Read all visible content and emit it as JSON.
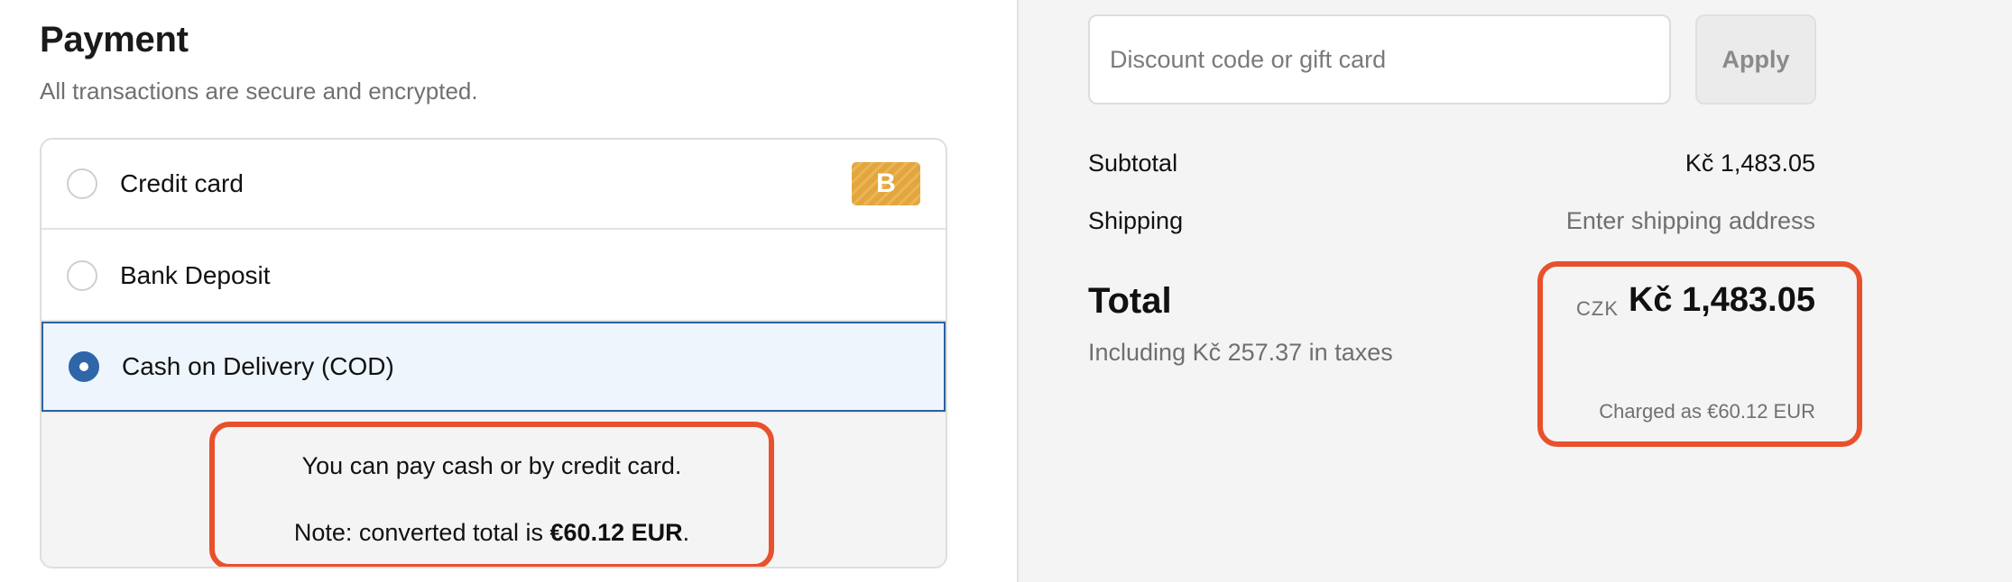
{
  "payment": {
    "title": "Payment",
    "subtitle": "All transactions are secure and encrypted.",
    "methods": [
      {
        "label": "Credit card",
        "selected": false,
        "badge": "B"
      },
      {
        "label": "Bank Deposit",
        "selected": false
      },
      {
        "label": "Cash on Delivery (COD)",
        "selected": true
      }
    ],
    "cod_info": {
      "line1": "You can pay cash or by credit card.",
      "line2_prefix": "Note: converted total is ",
      "line2_amount": "€60.12 EUR",
      "line2_suffix": "."
    }
  },
  "summary": {
    "discount_placeholder": "Discount code or gift card",
    "discount_value": "",
    "apply_label": "Apply",
    "subtotal_label": "Subtotal",
    "subtotal_value": "Kč 1,483.05",
    "shipping_label": "Shipping",
    "shipping_value": "Enter shipping address",
    "total_label": "Total",
    "tax_note": "Including Kč 257.37 in taxes",
    "currency_code": "CZK",
    "total_value": "Kč 1,483.05",
    "charged_as": "Charged as €60.12 EUR"
  },
  "colors": {
    "highlight_border": "#e9502c",
    "selected_radio": "#2f66a8",
    "selected_row_bg": "#eff5fd",
    "badge": "#e3a63c"
  }
}
